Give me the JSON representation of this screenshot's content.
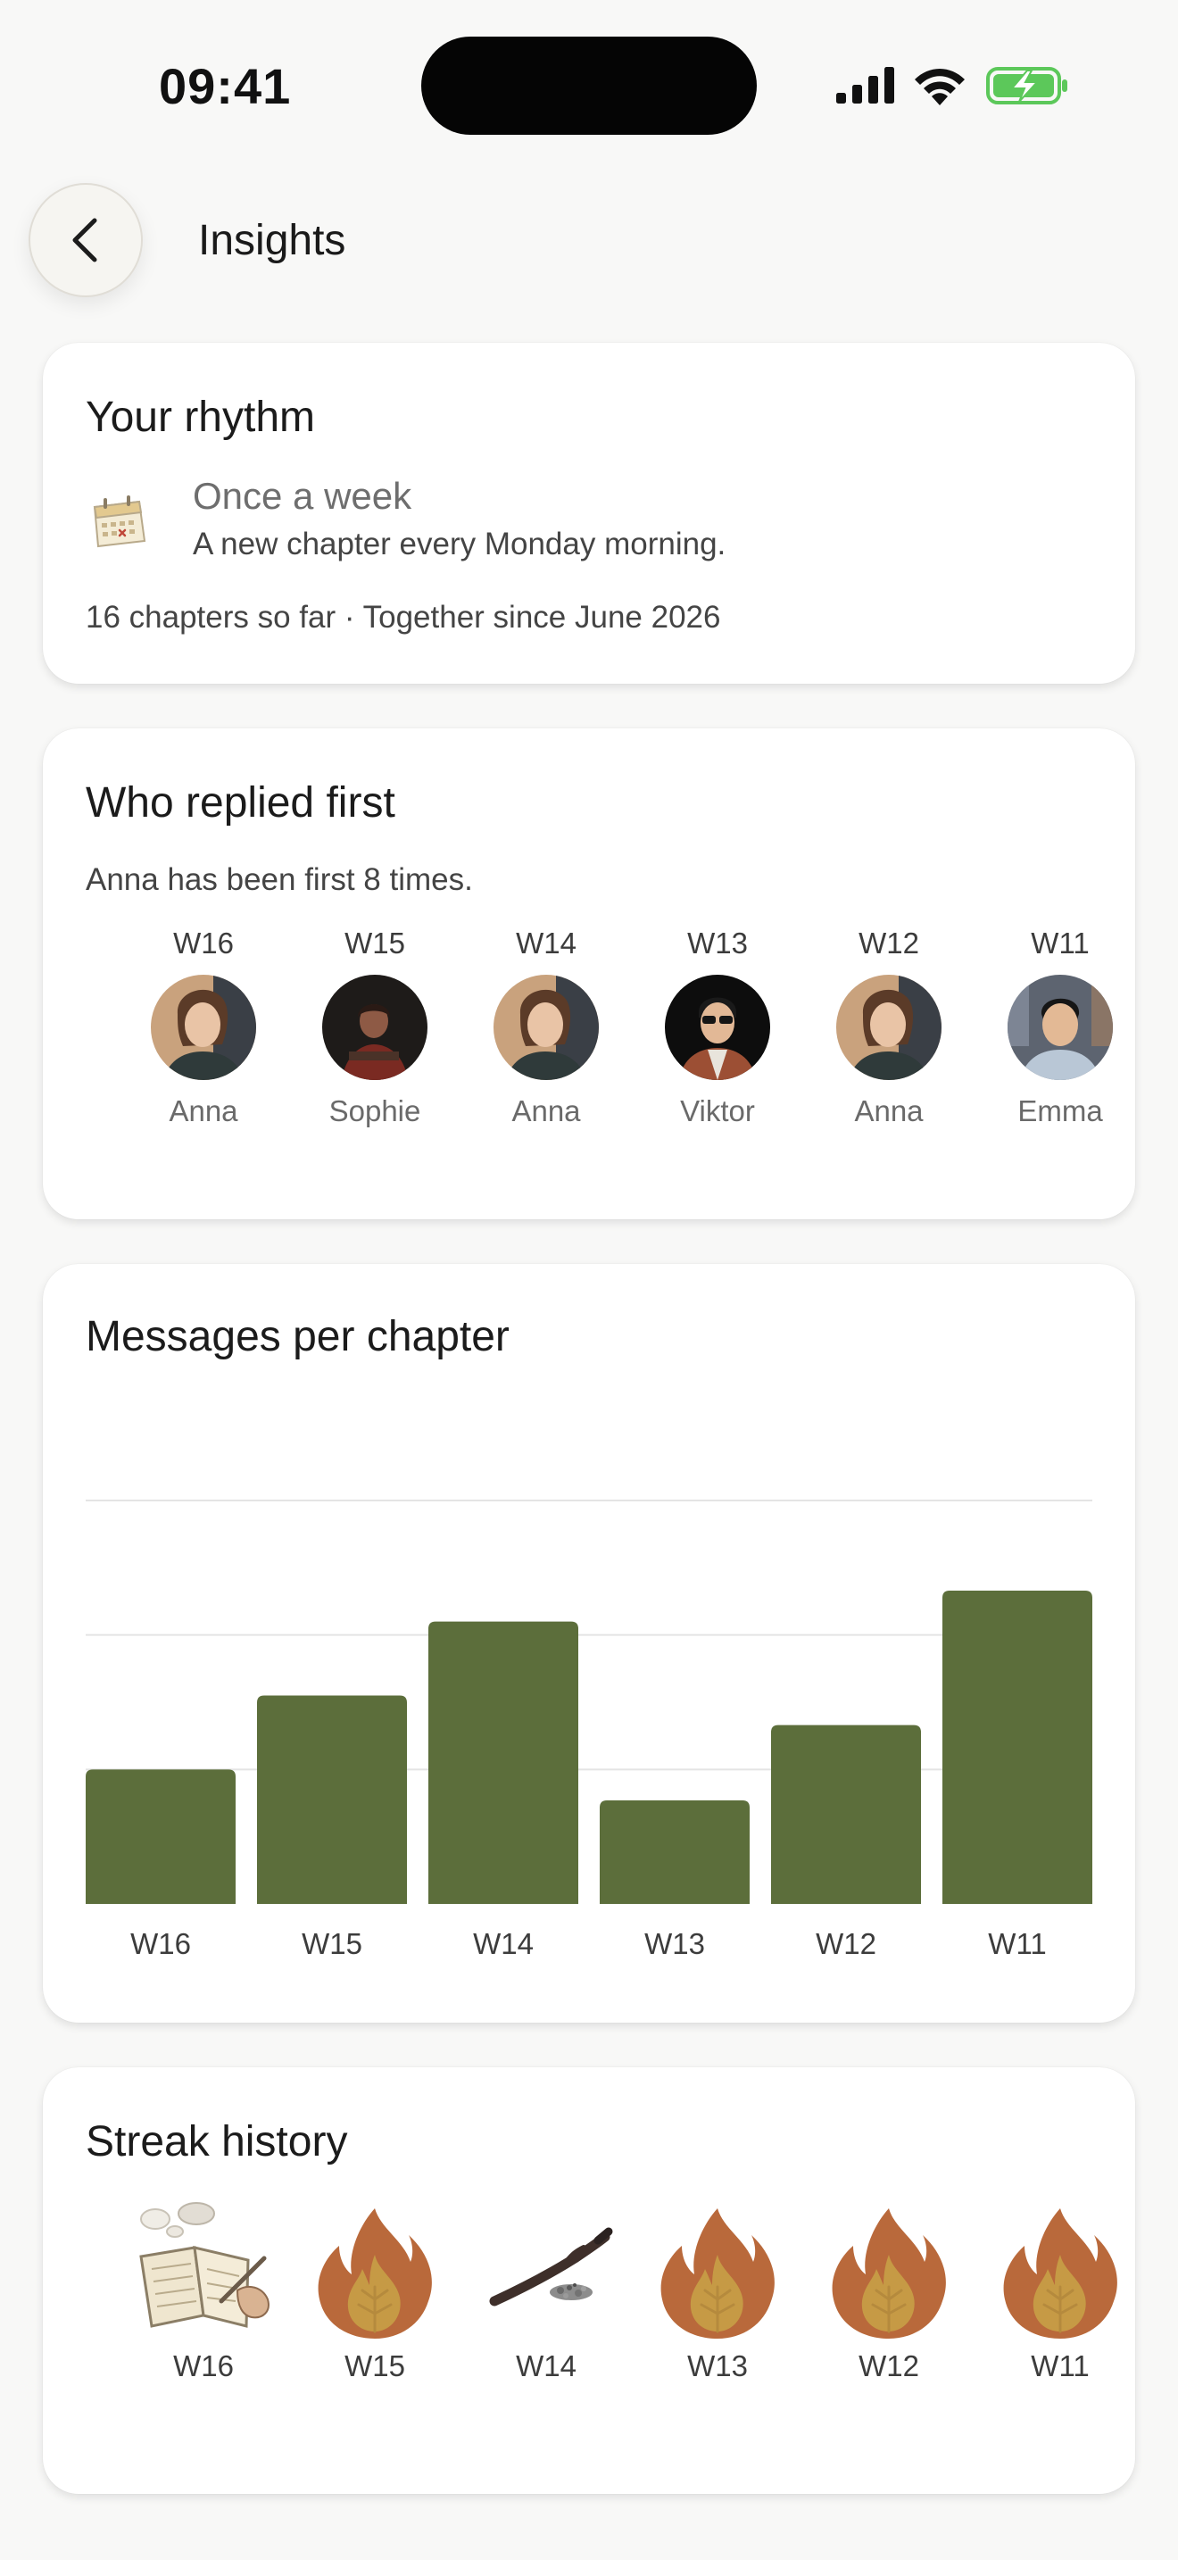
{
  "status_bar": {
    "time": "09:41"
  },
  "header": {
    "title": "Insights",
    "back_icon": "chevron-left-icon"
  },
  "rhythm": {
    "title": "Your rhythm",
    "icon": "calendar-icon",
    "label": "Once a week",
    "description": "A new chapter every Monday morning.",
    "summary": "16 chapters so far · Together since June 2026"
  },
  "replied_first": {
    "title": "Who replied first",
    "summary": "Anna has been first 8 times.",
    "entries": [
      {
        "week": "W16",
        "name": "Anna"
      },
      {
        "week": "W15",
        "name": "Sophie"
      },
      {
        "week": "W14",
        "name": "Anna"
      },
      {
        "week": "W13",
        "name": "Viktor"
      },
      {
        "week": "W12",
        "name": "Anna"
      },
      {
        "week": "W11",
        "name": "Emma"
      }
    ]
  },
  "messages_chart": {
    "title": "Messages per chapter",
    "bar_color": "#5c6e3b",
    "grid_color": "#e4e4e4"
  },
  "chart_data": {
    "type": "bar",
    "categories": [
      "W16",
      "W15",
      "W14",
      "W13",
      "W12",
      "W11"
    ],
    "values": [
      10,
      15.5,
      21,
      7.7,
      13.3,
      23.3
    ],
    "ylim": [
      0,
      30
    ],
    "grid": true,
    "xlabel": "",
    "ylabel": ""
  },
  "streak": {
    "title": "Streak history",
    "entries": [
      {
        "week": "W16",
        "icon": "journal-writing-icon"
      },
      {
        "week": "W15",
        "icon": "flame-icon"
      },
      {
        "week": "W14",
        "icon": "burnt-stick-icon"
      },
      {
        "week": "W13",
        "icon": "flame-icon"
      },
      {
        "week": "W12",
        "icon": "flame-icon"
      },
      {
        "week": "W11",
        "icon": "flame-icon"
      }
    ]
  },
  "colors": {
    "background": "#f8f8f7",
    "card": "#ffffff",
    "accent_green": "#5c6e3b",
    "flame_outer": "#b9693b",
    "flame_inner": "#c69a45"
  }
}
